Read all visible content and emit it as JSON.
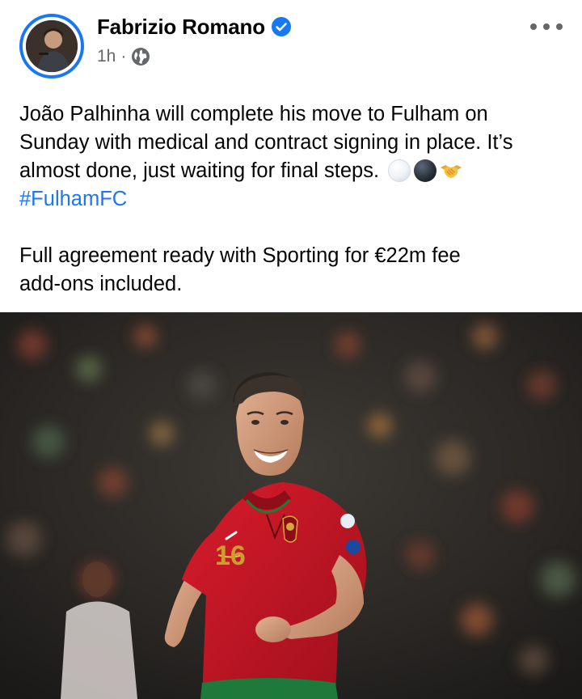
{
  "post": {
    "author": {
      "name": "Fabrizio Romano",
      "verified": true
    },
    "timestamp": "1h",
    "separator": "·",
    "audience_icon": "globe-icon",
    "more_icon": "more-options-icon",
    "text": {
      "line1": "João Palhinha will complete his move to Fulham on",
      "line2": "Sunday with medical and contract signing in place. It’s",
      "line3": "almost done, just waiting for final steps.",
      "emojis": [
        "white-circle-emoji",
        "black-circle-emoji",
        "handshake-emoji"
      ],
      "hashtag": "#FulhamFC",
      "paragraph2_line1": "Full agreement ready with Sporting for €22m fee",
      "paragraph2_line2": "add-ons included."
    },
    "photo": {
      "jersey_number": "16"
    }
  },
  "colors": {
    "accent": "#1877f2",
    "text": "#050505",
    "secondary": "#65676b",
    "jersey_red": "#c8102e",
    "shorts_green": "#1e7a3a"
  }
}
